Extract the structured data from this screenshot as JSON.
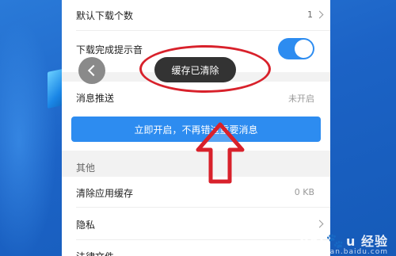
{
  "settings": {
    "default_download_count": {
      "label": "默认下载个数",
      "value": "1"
    },
    "download_complete_sound": {
      "label": "下载完成提示音"
    },
    "message_push": {
      "label": "消息推送",
      "value": "未开启"
    },
    "cta_label": "立即开启，不再错过重要消息",
    "section_other": "其他",
    "clear_cache": {
      "label": "清除应用缓存",
      "value": "0 KB"
    },
    "privacy": {
      "label": "隐私"
    },
    "legal": {
      "label": "法律文件"
    }
  },
  "toast": {
    "text": "缓存已清除"
  },
  "watermark": {
    "brand": "Bai",
    "brand2": "u",
    "suffix": "经验",
    "sub": "jingyan.baidu.com"
  }
}
